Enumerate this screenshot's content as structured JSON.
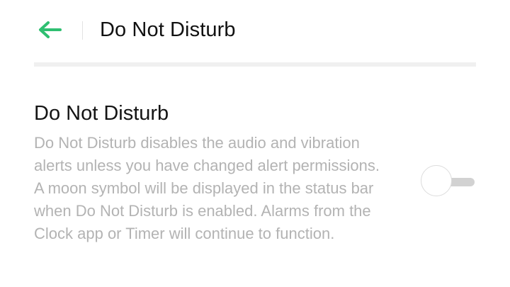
{
  "header": {
    "back_icon": "arrow-left-icon",
    "title": "Do Not Disturb"
  },
  "setting": {
    "title": "Do Not Disturb",
    "description": "Do Not Disturb disables the audio and vibration alerts unless you have changed alert permissions. A moon symbol will be displayed in the status bar when Do Not Disturb is enabled. Alarms from the Clock app or Timer will continue to function.",
    "toggle_on": false
  },
  "colors": {
    "accent": "#2fbf71",
    "title_text": "#111111",
    "description_text": "#b3b3b3",
    "toggle_track_off": "#d2d2d2"
  }
}
